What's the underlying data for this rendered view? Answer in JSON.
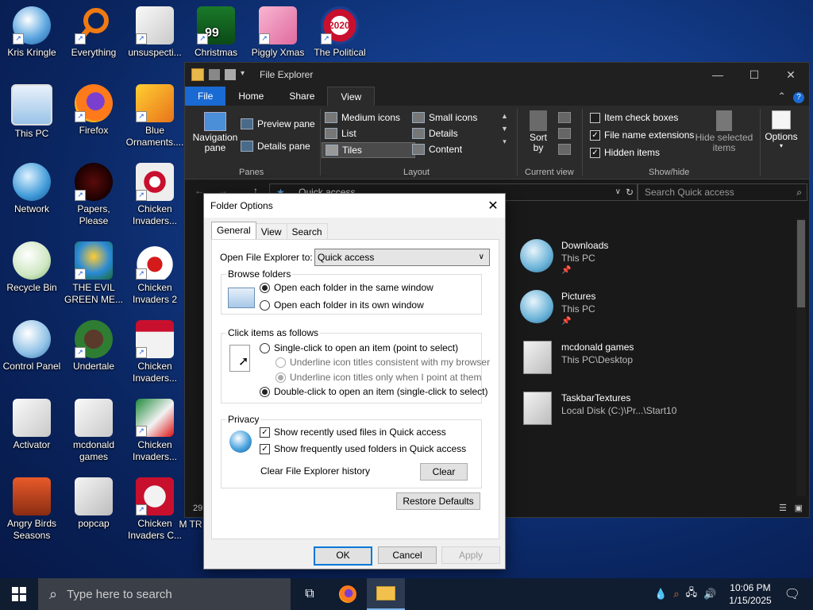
{
  "desktop": {
    "icons": [
      {
        "label": "Kris Kringle"
      },
      {
        "label": "Everything"
      },
      {
        "label": "unsuspecti..."
      },
      {
        "label": "Christmas"
      },
      {
        "label": "Piggly Xmas"
      },
      {
        "label": "The Political"
      },
      {
        "label": "This PC"
      },
      {
        "label": "Firefox"
      },
      {
        "label": "Blue Ornaments...."
      },
      {
        "label": "Network"
      },
      {
        "label": "Papers, Please"
      },
      {
        "label": "Chicken Invaders..."
      },
      {
        "label": "Recycle Bin"
      },
      {
        "label": "THE EVIL GREEN ME..."
      },
      {
        "label": "Chicken Invaders 2"
      },
      {
        "label": "Control Panel"
      },
      {
        "label": "Undertale"
      },
      {
        "label": "Chicken Invaders..."
      },
      {
        "label": "Activator"
      },
      {
        "label": "mcdonald games"
      },
      {
        "label": "Chicken Invaders..."
      },
      {
        "label": "Angry Birds Seasons"
      },
      {
        "label": "popcap"
      },
      {
        "label": "Chicken Invaders C..."
      },
      {
        "label": "M TR"
      }
    ],
    "badges": {
      "christmas": "99",
      "political": "2020"
    }
  },
  "explorer": {
    "title": "File Explorer",
    "tabs": {
      "file": "File",
      "home": "Home",
      "share": "Share",
      "view": "View"
    },
    "ribbon": {
      "navigation_pane": "Navigation pane",
      "preview_pane": "Preview pane",
      "details_pane": "Details pane",
      "panes_group": "Panes",
      "medium_icons": "Medium icons",
      "small_icons": "Small icons",
      "list": "List",
      "details": "Details",
      "tiles": "Tiles",
      "content": "Content",
      "layout_group": "Layout",
      "sort_by": "Sort by",
      "current_view_group": "Current view",
      "item_check_boxes": "Item check boxes",
      "file_name_extensions": "File name extensions",
      "hidden_items": "Hidden items",
      "hide_selected_items": "Hide selected items",
      "show_hide_group": "Show/hide",
      "options": "Options"
    },
    "address": "Quick access",
    "search_placeholder": "Search Quick access",
    "items": [
      {
        "name": "Downloads",
        "location": "This PC"
      },
      {
        "name": "Pictures",
        "location": "This PC"
      },
      {
        "name": "mcdonald games",
        "location": "This PC\\Desktop"
      },
      {
        "name": "TaskbarTextures",
        "location": "Local Disk (C:)\\Pr...\\Start10"
      }
    ],
    "status_count": "29"
  },
  "dialog": {
    "title": "Folder Options",
    "tabs": {
      "general": "General",
      "view": "View",
      "search": "Search"
    },
    "open_label": "Open File Explorer to:",
    "open_value": "Quick access",
    "browse": {
      "legend": "Browse folders",
      "same_window": "Open each folder in the same window",
      "own_window": "Open each folder in its own window"
    },
    "click": {
      "legend": "Click items as follows",
      "single": "Single-click to open an item (point to select)",
      "underline_browser": "Underline icon titles consistent with my browser",
      "underline_point": "Underline icon titles only when I point at them",
      "double": "Double-click to open an item (single-click to select)"
    },
    "privacy": {
      "legend": "Privacy",
      "recent_files": "Show recently used files in Quick access",
      "frequent_folders": "Show frequently used folders in Quick access",
      "clear_history": "Clear File Explorer history",
      "clear_button": "Clear"
    },
    "restore_defaults": "Restore Defaults",
    "ok": "OK",
    "cancel": "Cancel",
    "apply": "Apply"
  },
  "taskbar": {
    "search_placeholder": "Type here to search",
    "time": "10:06 PM",
    "date": "1/15/2025"
  },
  "colors": {
    "accent": "#0078d7",
    "file_tab": "#1a6ad3",
    "taskbar": "#101c30"
  }
}
